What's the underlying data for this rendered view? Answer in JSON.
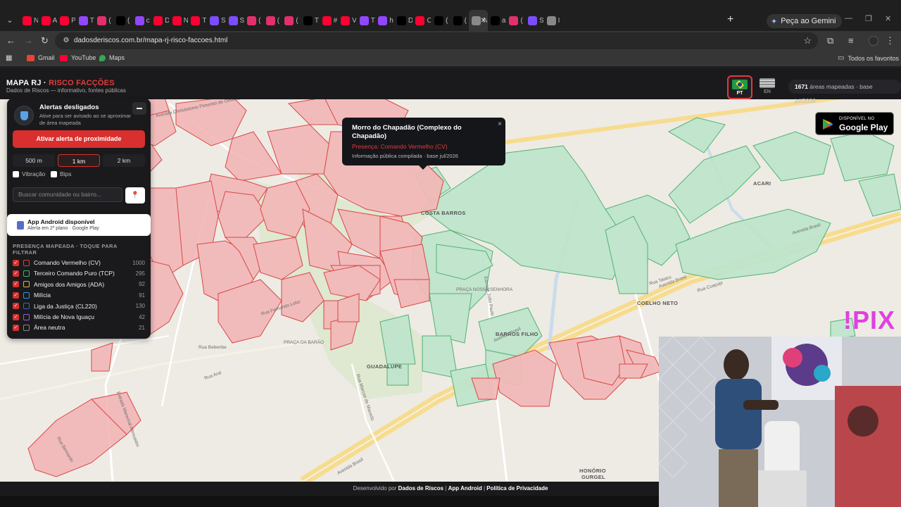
{
  "browser": {
    "tabs": [
      {
        "label": "N",
        "color": "#ff0033"
      },
      {
        "label": "A",
        "color": "#ff0033"
      },
      {
        "label": "P",
        "color": "#ff0033"
      },
      {
        "label": "T",
        "color": "#9146ff"
      },
      {
        "label": "(",
        "color": "#e1306c"
      },
      {
        "label": "(",
        "color": "#000000"
      },
      {
        "label": "c",
        "color": "#9146ff"
      },
      {
        "label": "D",
        "color": "#ff0033"
      },
      {
        "label": "N",
        "color": "#ff0033"
      },
      {
        "label": "T",
        "color": "#ff0033"
      },
      {
        "label": "S",
        "color": "#7c4dff"
      },
      {
        "label": "S",
        "color": "#7c4dff"
      },
      {
        "label": "(",
        "color": "#e1306c"
      },
      {
        "label": "(",
        "color": "#e1306c"
      },
      {
        "label": "(",
        "color": "#e1306c"
      },
      {
        "label": "T",
        "color": "#000000"
      },
      {
        "label": "#",
        "color": "#ff0033"
      },
      {
        "label": "V",
        "color": "#ff0033"
      },
      {
        "label": "T",
        "color": "#9146ff"
      },
      {
        "label": "h",
        "color": "#9146ff"
      },
      {
        "label": "D",
        "color": "#000000"
      },
      {
        "label": "C",
        "color": "#ff0033"
      },
      {
        "label": "(",
        "color": "#000000"
      },
      {
        "label": "(",
        "color": "#000000"
      },
      {
        "label": "N",
        "color": "#888888"
      },
      {
        "label": "a",
        "color": "#000000"
      },
      {
        "label": "(",
        "color": "#e1306c"
      },
      {
        "label": "S",
        "color": "#7c4dff"
      },
      {
        "label": "I",
        "color": "#888888"
      }
    ],
    "new_tab": "+",
    "gemini_label": "Peça ao Gemini",
    "url": "dadosderiscos.com.br/mapa-rj-risco-faccoes.html",
    "bookmarks": [
      {
        "label": "Gmail",
        "color": "#ea4335"
      },
      {
        "label": "YouTube",
        "color": "#ff0033"
      },
      {
        "label": "Maps",
        "color": "#34a853"
      }
    ],
    "all_bookmarks": "Todos os favoritos"
  },
  "header": {
    "brand_white": "MAPA RJ · ",
    "brand_red": "RISCO FACÇÕES",
    "brand_sub": "Dados de Riscos — informativo, fontes públicas",
    "lang_pt": "PT",
    "lang_en": "EN",
    "count": "1671",
    "count_text": " áreas mapeadas · base jul/2026"
  },
  "gplay": {
    "small": "DISPONÍVEL NO",
    "big": "Google Play"
  },
  "popup": {
    "title": "Morro do Chapadão (Complexo do Chapadão)",
    "presence": "Presença: Comando Vermelho (CV)",
    "source": "Informação pública compilada · base jul/2026",
    "close": "×"
  },
  "panel": {
    "alert_title": "Alertas desligados",
    "alert_sub": "Ative para ser avisado ao se aproximar de área mapeada",
    "activate": "Ativar alerta de proximidade",
    "radius": [
      "500 m",
      "1 km",
      "2 km"
    ],
    "vibracao": "Vibração",
    "bips": "Bips",
    "search_placeholder": "Buscar comunidade ou bairro...",
    "android_title": "App Android disponível",
    "android_sub": "Alerta em 2º plano · Google Play",
    "presence_title": "PRESENÇA MAPEADA · TOQUE PARA FILTRAR",
    "factions": [
      {
        "name": "Comando Vermelho (CV)",
        "count": "1000",
        "color": "#e23b3b"
      },
      {
        "name": "Terceiro Comando Puro (TCP)",
        "count": "295",
        "color": "#3fb86b"
      },
      {
        "name": "Amigos dos Amigos (ADA)",
        "count": "92",
        "color": "#e6b533"
      },
      {
        "name": "Milícia",
        "count": "91",
        "color": "#3a8fe0"
      },
      {
        "name": "Liga da Justiça (CL220)",
        "count": "130",
        "color": "#3a60d0"
      },
      {
        "name": "Milícia de Nova Iguaçu",
        "count": "42",
        "color": "#9b59d0"
      },
      {
        "name": "Área neutra",
        "count": "21",
        "color": "#888888"
      }
    ]
  },
  "map_labels": {
    "costa_barros": "COSTA BARROS",
    "acari": "ACARI",
    "coelho_neto": "COELHO NETO",
    "barros_filho": "BARROS FILHO",
    "guadalupe": "GUADALUPE",
    "honorio": "HONÓRIO",
    "gurgel": "GURGEL",
    "av_brasil_1": "Avenida Brasil",
    "av_brasil_2": "Avenida Brasil",
    "av_brasil_3": "Avenida Brasil",
    "av_brasil_4": "Avenida Brasil",
    "rua_fernando_lobo": "Rua Fernando Lobo",
    "rua_beberibe": "Rua Beberibe",
    "rua_arai": "Rua Arai",
    "estrada_pedra": "Estrada João Paulo",
    "praca_barao": "PRAÇA DA BARÃO",
    "rua_marcos": "Rua Marcos de Macedo",
    "rua_taiacu": "Rua Taiacu",
    "rua_cuacupi": "Rua Cuaçupi",
    "estrada_marechal": "Estrada Marechal Alencastro",
    "rua_bernardo": "Rua Bernardo",
    "av_chrisostomo": "Avenida Chrisóstomo Pimentel de Oliveira",
    "praca_nossa": "PRAÇA NOSSA SENHORA",
    "pix": "!PIX"
  },
  "footer": {
    "prefix": "Desenvolvido por ",
    "dev": "Dados de Riscos",
    "sep1": " | ",
    "app": "App Android",
    "sep2": " | ",
    "privacy": "Política de Privacidade"
  }
}
